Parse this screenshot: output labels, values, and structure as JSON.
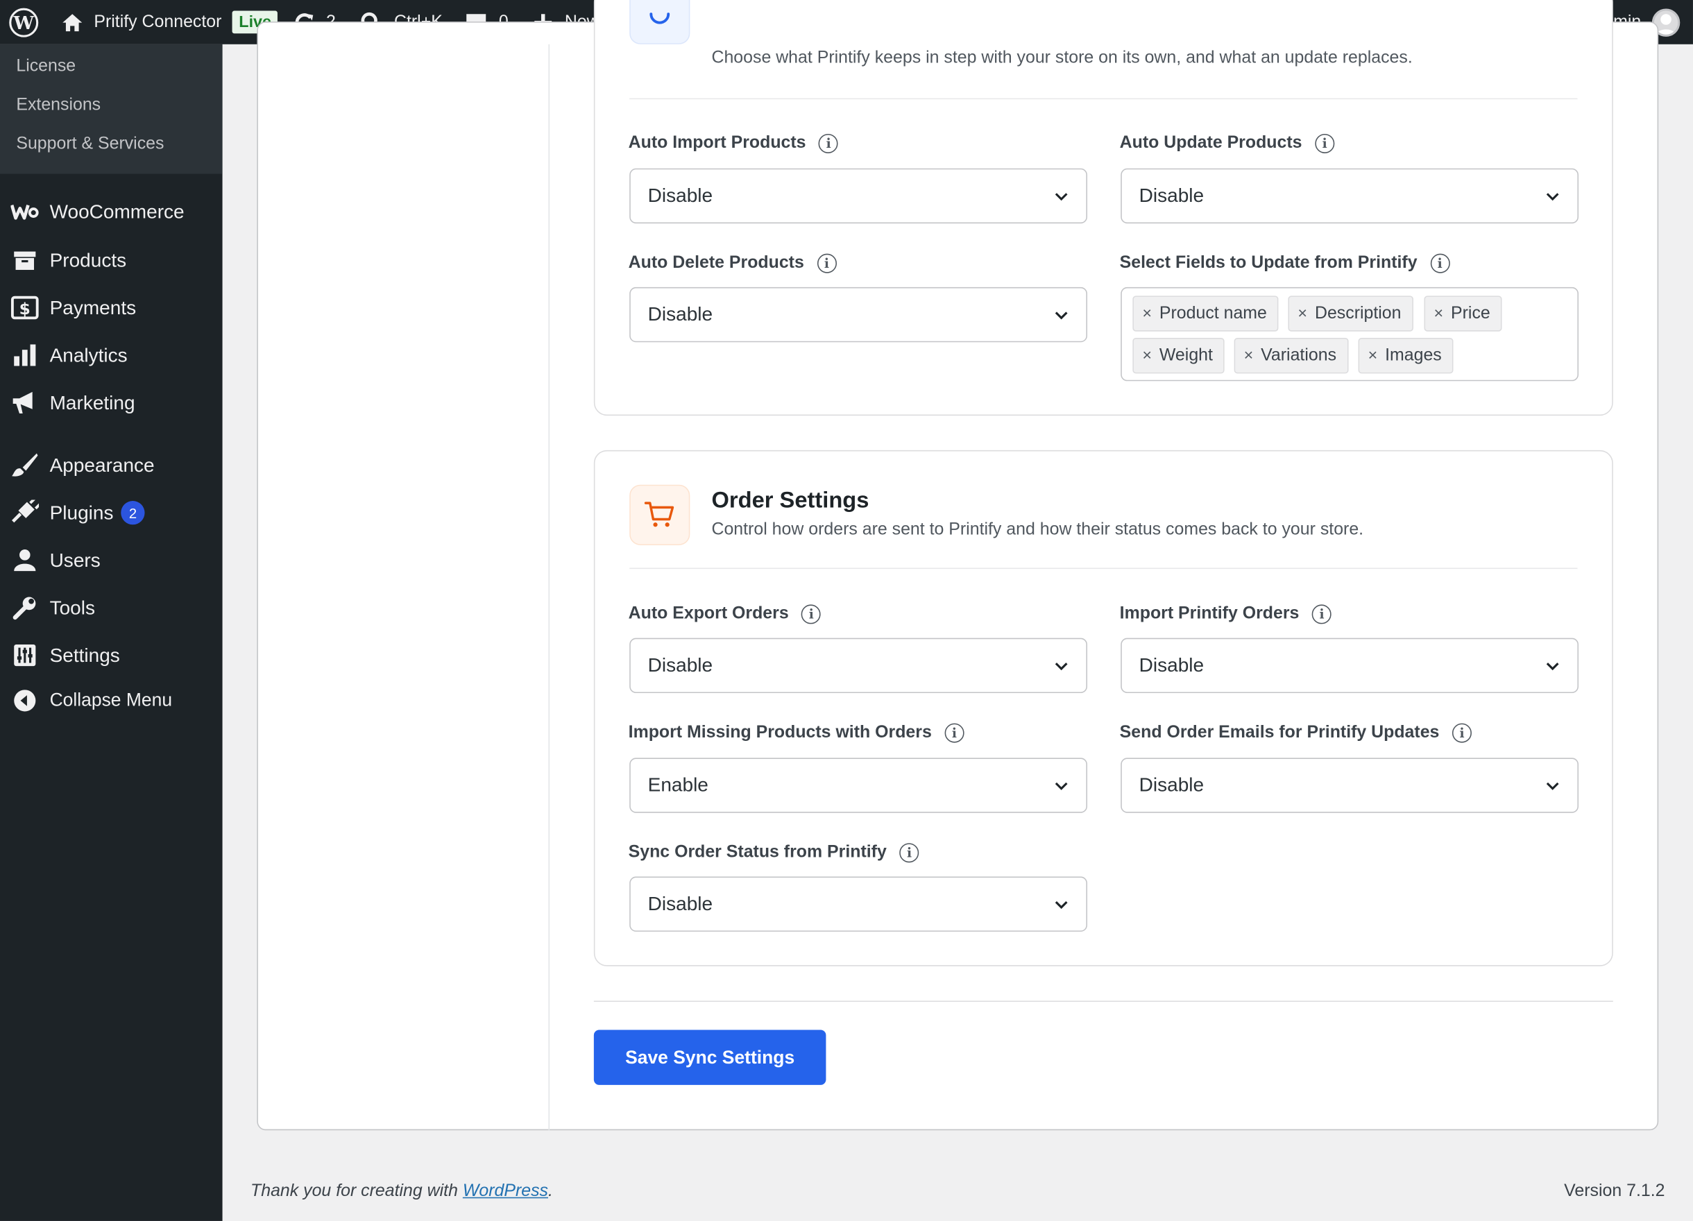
{
  "adminbar": {
    "site_name": "Pritify Connector",
    "live_badge": "Live",
    "updates_count": "2",
    "search_shortcut": "Ctrl+K",
    "comments_count": "0",
    "new_label": "New",
    "howdy": "Howdy, admin"
  },
  "sidebar": {
    "submenu": [
      "License",
      "Extensions",
      "Support & Services"
    ],
    "items": [
      {
        "label": "WooCommerce",
        "icon": "woo-icon"
      },
      {
        "label": "Products",
        "icon": "archive-icon"
      },
      {
        "label": "Payments",
        "icon": "dollar-icon"
      },
      {
        "label": "Analytics",
        "icon": "bar-chart-icon"
      },
      {
        "label": "Marketing",
        "icon": "megaphone-icon"
      },
      {
        "label": "Appearance",
        "icon": "paintbrush-icon"
      },
      {
        "label": "Plugins",
        "icon": "plugin-icon",
        "badge": "2"
      },
      {
        "label": "Users",
        "icon": "user-icon"
      },
      {
        "label": "Tools",
        "icon": "wrench-icon"
      },
      {
        "label": "Settings",
        "icon": "sliders-icon"
      },
      {
        "label": "Collapse Menu",
        "icon": "collapse-icon"
      }
    ]
  },
  "product_card": {
    "description": "Choose what Printify keeps in step with your store on its own, and what an update replaces.",
    "fields": {
      "auto_import": {
        "label": "Auto Import Products",
        "value": "Disable"
      },
      "auto_update": {
        "label": "Auto Update Products",
        "value": "Disable"
      },
      "auto_delete": {
        "label": "Auto Delete Products",
        "value": "Disable"
      },
      "fields_update": {
        "label": "Select Fields to Update from Printify",
        "tags": [
          "Product name",
          "Description",
          "Price",
          "Weight",
          "Variations",
          "Images"
        ]
      }
    }
  },
  "order_card": {
    "title": "Order Settings",
    "description": "Control how orders are sent to Printify and how their status comes back to your store.",
    "fields": {
      "auto_export": {
        "label": "Auto Export Orders",
        "value": "Disable"
      },
      "import_orders": {
        "label": "Import Printify Orders",
        "value": "Disable"
      },
      "import_missing": {
        "label": "Import Missing Products with Orders",
        "value": "Enable"
      },
      "send_emails": {
        "label": "Send Order Emails for Printify Updates",
        "value": "Disable"
      },
      "sync_status": {
        "label": "Sync Order Status from Printify",
        "value": "Disable"
      }
    }
  },
  "save_button": "Save Sync Settings",
  "footer": {
    "thanks_prefix": "Thank you for creating with ",
    "wp_link": "WordPress",
    "thanks_suffix": ".",
    "version": "Version 7.1.2"
  },
  "colors": {
    "accent": "#2563eb",
    "sidebar_bg": "#1d2327",
    "order_icon": "#e8580c"
  }
}
